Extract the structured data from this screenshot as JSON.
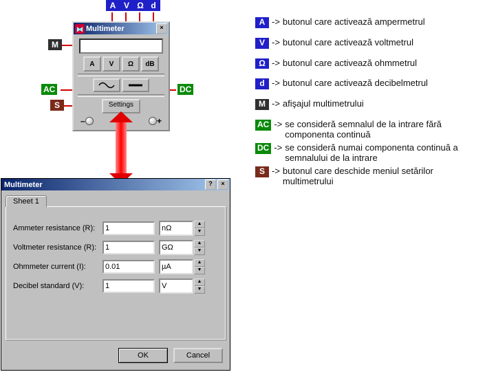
{
  "toolbar": {
    "title": "Multimeter",
    "modes": {
      "a": "A",
      "v": "V",
      "ohm": "Ω",
      "db": "dB"
    },
    "settings_label": "Settings",
    "terminal_minus": "–",
    "terminal_plus": "+"
  },
  "dialog": {
    "title": "Multimeter",
    "tab": "Sheet 1",
    "rows": {
      "ammeter": {
        "label": "Ammeter resistance (R):",
        "value": "1",
        "unit": "nΩ"
      },
      "voltmeter": {
        "label": "Voltmeter resistance (R):",
        "value": "1",
        "unit": "GΩ"
      },
      "ohmmeter": {
        "label": "Ohmmeter current (I):",
        "value": "0.01",
        "unit": "µA"
      },
      "decibel": {
        "label": "Decibel standard (V):",
        "value": "1",
        "unit": "V"
      }
    },
    "ok": "OK",
    "cancel": "Cancel"
  },
  "labels": {
    "A": "A",
    "V": "V",
    "Ohm": "Ω",
    "d": "d",
    "M": "M",
    "AC": "AC",
    "DC": "DC",
    "S": "S"
  },
  "legend": {
    "arrow": "->",
    "A": "butonul care activează ampermetrul",
    "V": "butonul care activează voltmetrul",
    "Ohm": "butonul care activează ohmmetrul",
    "d": "butonul care activează decibelmetrul",
    "M": "afişajul multimetrului",
    "AC": "se consideră semnalul de la intrare fără componenta continuă",
    "DC": "se consideră numai componenta continuă a semnalului de la intrare",
    "S": "butonul care deschide meniul setărilor multimetrului"
  }
}
